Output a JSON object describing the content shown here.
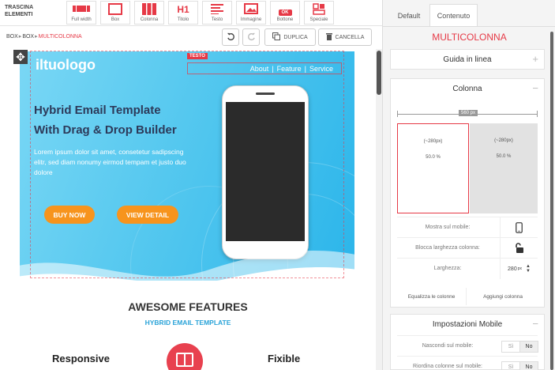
{
  "toolbar": {
    "drag_label": "TRASCINA ELEMENTI",
    "items": [
      {
        "label": "Full width",
        "icon": "full-width-icon"
      },
      {
        "label": "Box",
        "icon": "box-icon"
      },
      {
        "label": "Colonna",
        "icon": "columns-icon"
      },
      {
        "label": "Titolo",
        "icon": "heading-icon",
        "glyph": "H1"
      },
      {
        "label": "Testo",
        "icon": "text-icon"
      },
      {
        "label": "Immagine",
        "icon": "image-icon"
      },
      {
        "label": "Bottone",
        "icon": "button-icon",
        "glyph": "OK"
      },
      {
        "label": "Speciale",
        "icon": "special-icon"
      }
    ]
  },
  "breadcrumb": {
    "items": [
      "BOX",
      "BOX"
    ],
    "current": "MULTICOLONNA"
  },
  "actions": {
    "undo": "undo-icon",
    "redo": "redo-icon",
    "duplicate": "DUPLICA",
    "delete": "CANCELLA"
  },
  "hero": {
    "logo": "iltuologo",
    "tag": "TESTO",
    "nav": [
      "About",
      "Feature",
      "Service"
    ],
    "nav_sep": "|",
    "title_line1": "Hybrid Email Template",
    "title_line2": "With Drag & Drop Builder",
    "body": "Lorem ipsum dolor sit amet, consetetur sadipscing elitr, sed diam nonumy eirmod tempam et justo duo dolore",
    "buy_label": "BUY NOW",
    "view_label": "VIEW DETAIL"
  },
  "features": {
    "title": "AWESOME FEATURES",
    "subtitle": "HYBRID EMAIL TEMPLATE",
    "left": "Responsive",
    "right": "Fixible"
  },
  "panel": {
    "tabs": [
      "Default",
      "Contenuto"
    ],
    "title": "MULTICOLONNA",
    "guide": "Guida in linea",
    "column_section": "Colonna",
    "total_width": "560 px",
    "columns": [
      {
        "width": "(~280px)",
        "percent": "50.0 %"
      },
      {
        "width": "(~280px)",
        "percent": "50.0 %"
      }
    ],
    "show_mobile": "Mostra sul mobile:",
    "lock_width": "Blocca larghezza colonna:",
    "width_label": "Larghezza:",
    "width_value": "280",
    "width_unit": "px",
    "equalize": "Equalizza le colonne",
    "add_column": "Aggiungi colonna",
    "mobile_section": "Impostazioni Mobile",
    "hide_mobile": "Nascondi sul mobile:",
    "reorder_mobile": "Riordina colonne sul mobile:",
    "yes": "Sì",
    "no": "No"
  },
  "colors": {
    "accent": "#e63946",
    "hero_start": "#7ad7f5",
    "hero_end": "#2bb5ea",
    "button": "#f7941d",
    "subtitle": "#2aa3d8",
    "title": "#2d3a5a"
  }
}
